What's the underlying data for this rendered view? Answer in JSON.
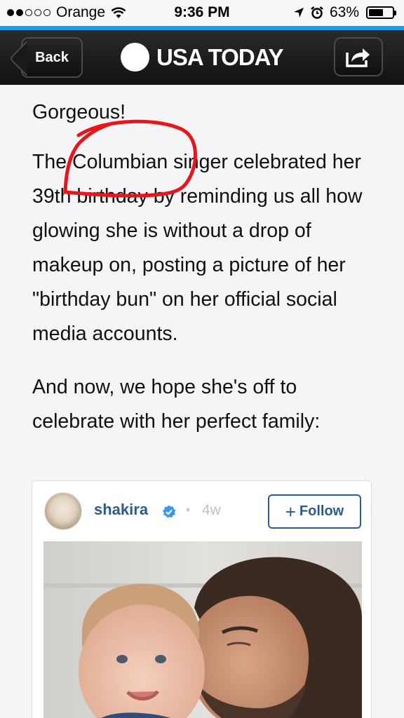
{
  "status_bar": {
    "carrier": "Orange",
    "time": "9:36 PM",
    "battery": "63%",
    "battery_level": 0.63,
    "signal_bars_filled": 2,
    "signal_bars_total": 5
  },
  "nav": {
    "back_label": "Back",
    "brand": "USA TODAY"
  },
  "article": {
    "paragraphs": [
      "Gorgeous!",
      "The Columbian singer celebrated her 39th birthday by reminding us all how glowing she is without a drop of makeup on, posting a picture of her \"birthday bun\" on her official social media accounts.",
      "And now, we hope she's off to celebrate with her perfect family:"
    ]
  },
  "embed": {
    "username": "shakira",
    "age": "4w",
    "follow_label": "Follow"
  },
  "colors": {
    "accent_blue": "#1d9bea",
    "instagram_blue": "#2c5b8c",
    "annotation_red": "#e8151b"
  }
}
